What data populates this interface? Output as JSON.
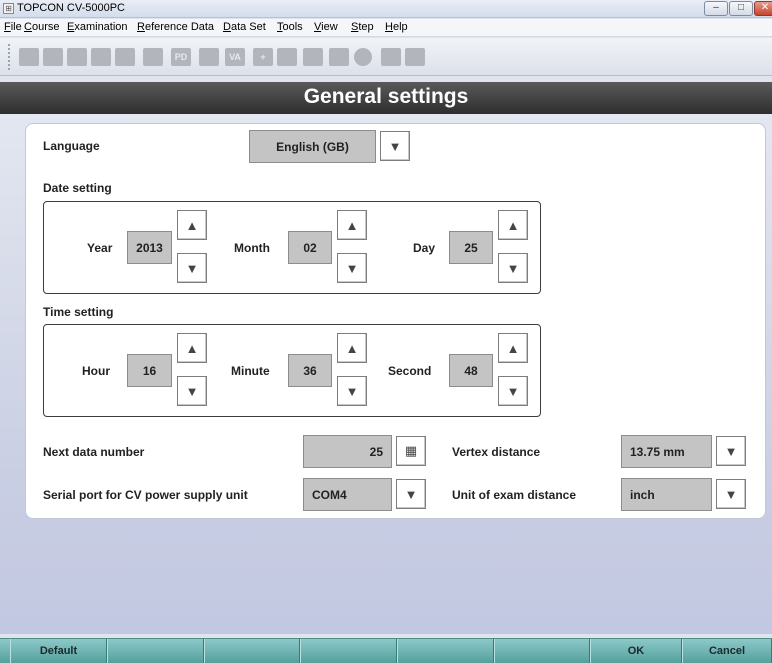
{
  "window": {
    "title": "TOPCON CV-5000PC",
    "minimize": "–",
    "maximize": "□",
    "close": "✕"
  },
  "menu": [
    "File",
    "Course",
    "Examination",
    "Reference Data",
    "Data Set",
    "Tools",
    "View",
    "Step",
    "Help"
  ],
  "toolbar": {
    "buttons": [
      {
        "icon": "briefcase-icon",
        "text": ""
      },
      {
        "icon": "person-icon",
        "text": ""
      },
      {
        "icon": "lens-icon",
        "text": ""
      },
      {
        "icon": "lens-pair-icon",
        "text": ""
      },
      {
        "icon": "phoropter-icon",
        "text": ""
      },
      {
        "icon": "folder-icon",
        "text": ""
      },
      {
        "icon": "pd-icon",
        "text": "PD"
      },
      {
        "icon": "square-icon",
        "text": ""
      },
      {
        "icon": "va-icon",
        "text": "VA"
      },
      {
        "icon": "add-icon",
        "text": "+"
      },
      {
        "icon": "flag-icon",
        "text": ""
      },
      {
        "icon": "bubble-icon",
        "text": ""
      },
      {
        "icon": "book-icon",
        "text": ""
      },
      {
        "icon": "circle-icon",
        "text": ""
      },
      {
        "icon": "printer-icon",
        "text": ""
      },
      {
        "icon": "wrench-icon",
        "text": ""
      }
    ]
  },
  "header": {
    "title": "General settings"
  },
  "language": {
    "label": "Language",
    "value": "English (GB)",
    "dropdown": "▼"
  },
  "date": {
    "label": "Date setting",
    "year_label": "Year",
    "year": "2013",
    "month_label": "Month",
    "month": "02",
    "day_label": "Day",
    "day": "25"
  },
  "time": {
    "label": "Time setting",
    "hour_label": "Hour",
    "hour": "16",
    "minute_label": "Minute",
    "minute": "36",
    "second_label": "Second",
    "second": "48"
  },
  "arrows": {
    "up": "▲",
    "down": "▼",
    "calc": "▦"
  },
  "next_data": {
    "label": "Next data number",
    "value": "25"
  },
  "serial": {
    "label": "Serial port for CV power supply unit",
    "value": "COM4"
  },
  "vertex": {
    "label": "Vertex distance",
    "value": "13.75 mm"
  },
  "exam_unit": {
    "label": "Unit of exam distance",
    "value": "inch"
  },
  "footer": {
    "default": "Default",
    "ok": "OK",
    "cancel": "Cancel"
  }
}
